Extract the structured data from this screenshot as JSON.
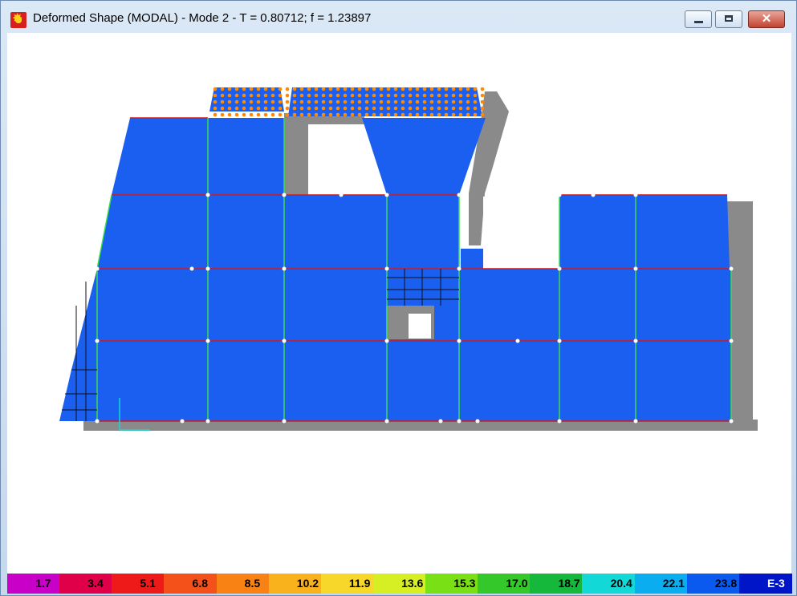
{
  "window": {
    "title": "Deformed Shape (MODAL) - Mode 2 - T = 0.80712;  f = 1.23897",
    "icons": {
      "app": "sap-logo-icon",
      "minimize": "minimize-icon",
      "maximize": "maximize-icon",
      "close": "close-icon"
    },
    "close_glyph": "✕"
  },
  "model": {
    "colors": {
      "shell": "#1a5ff0",
      "undeformed_shadow": "#8a8a8a",
      "edge_red": "#cf1b1b",
      "edge_green": "#3ddc4c",
      "joint": "#ffffff",
      "mesh_dot": "#ff8a00"
    }
  },
  "legend": {
    "colors": [
      "#c800c8",
      "#e0004a",
      "#ee1a1a",
      "#f4501a",
      "#f88214",
      "#fab21c",
      "#f7d82a",
      "#d6ee24",
      "#78e014",
      "#35c82a",
      "#16b83c",
      "#13d8d8",
      "#0aaef0",
      "#0a5af0",
      "#0014c8"
    ],
    "values": [
      "1.7",
      "3.4",
      "5.1",
      "6.8",
      "8.5",
      "10.2",
      "11.9",
      "13.6",
      "15.3",
      "17.0",
      "18.7",
      "20.4",
      "22.1",
      "23.8"
    ],
    "unit": "E-3"
  }
}
